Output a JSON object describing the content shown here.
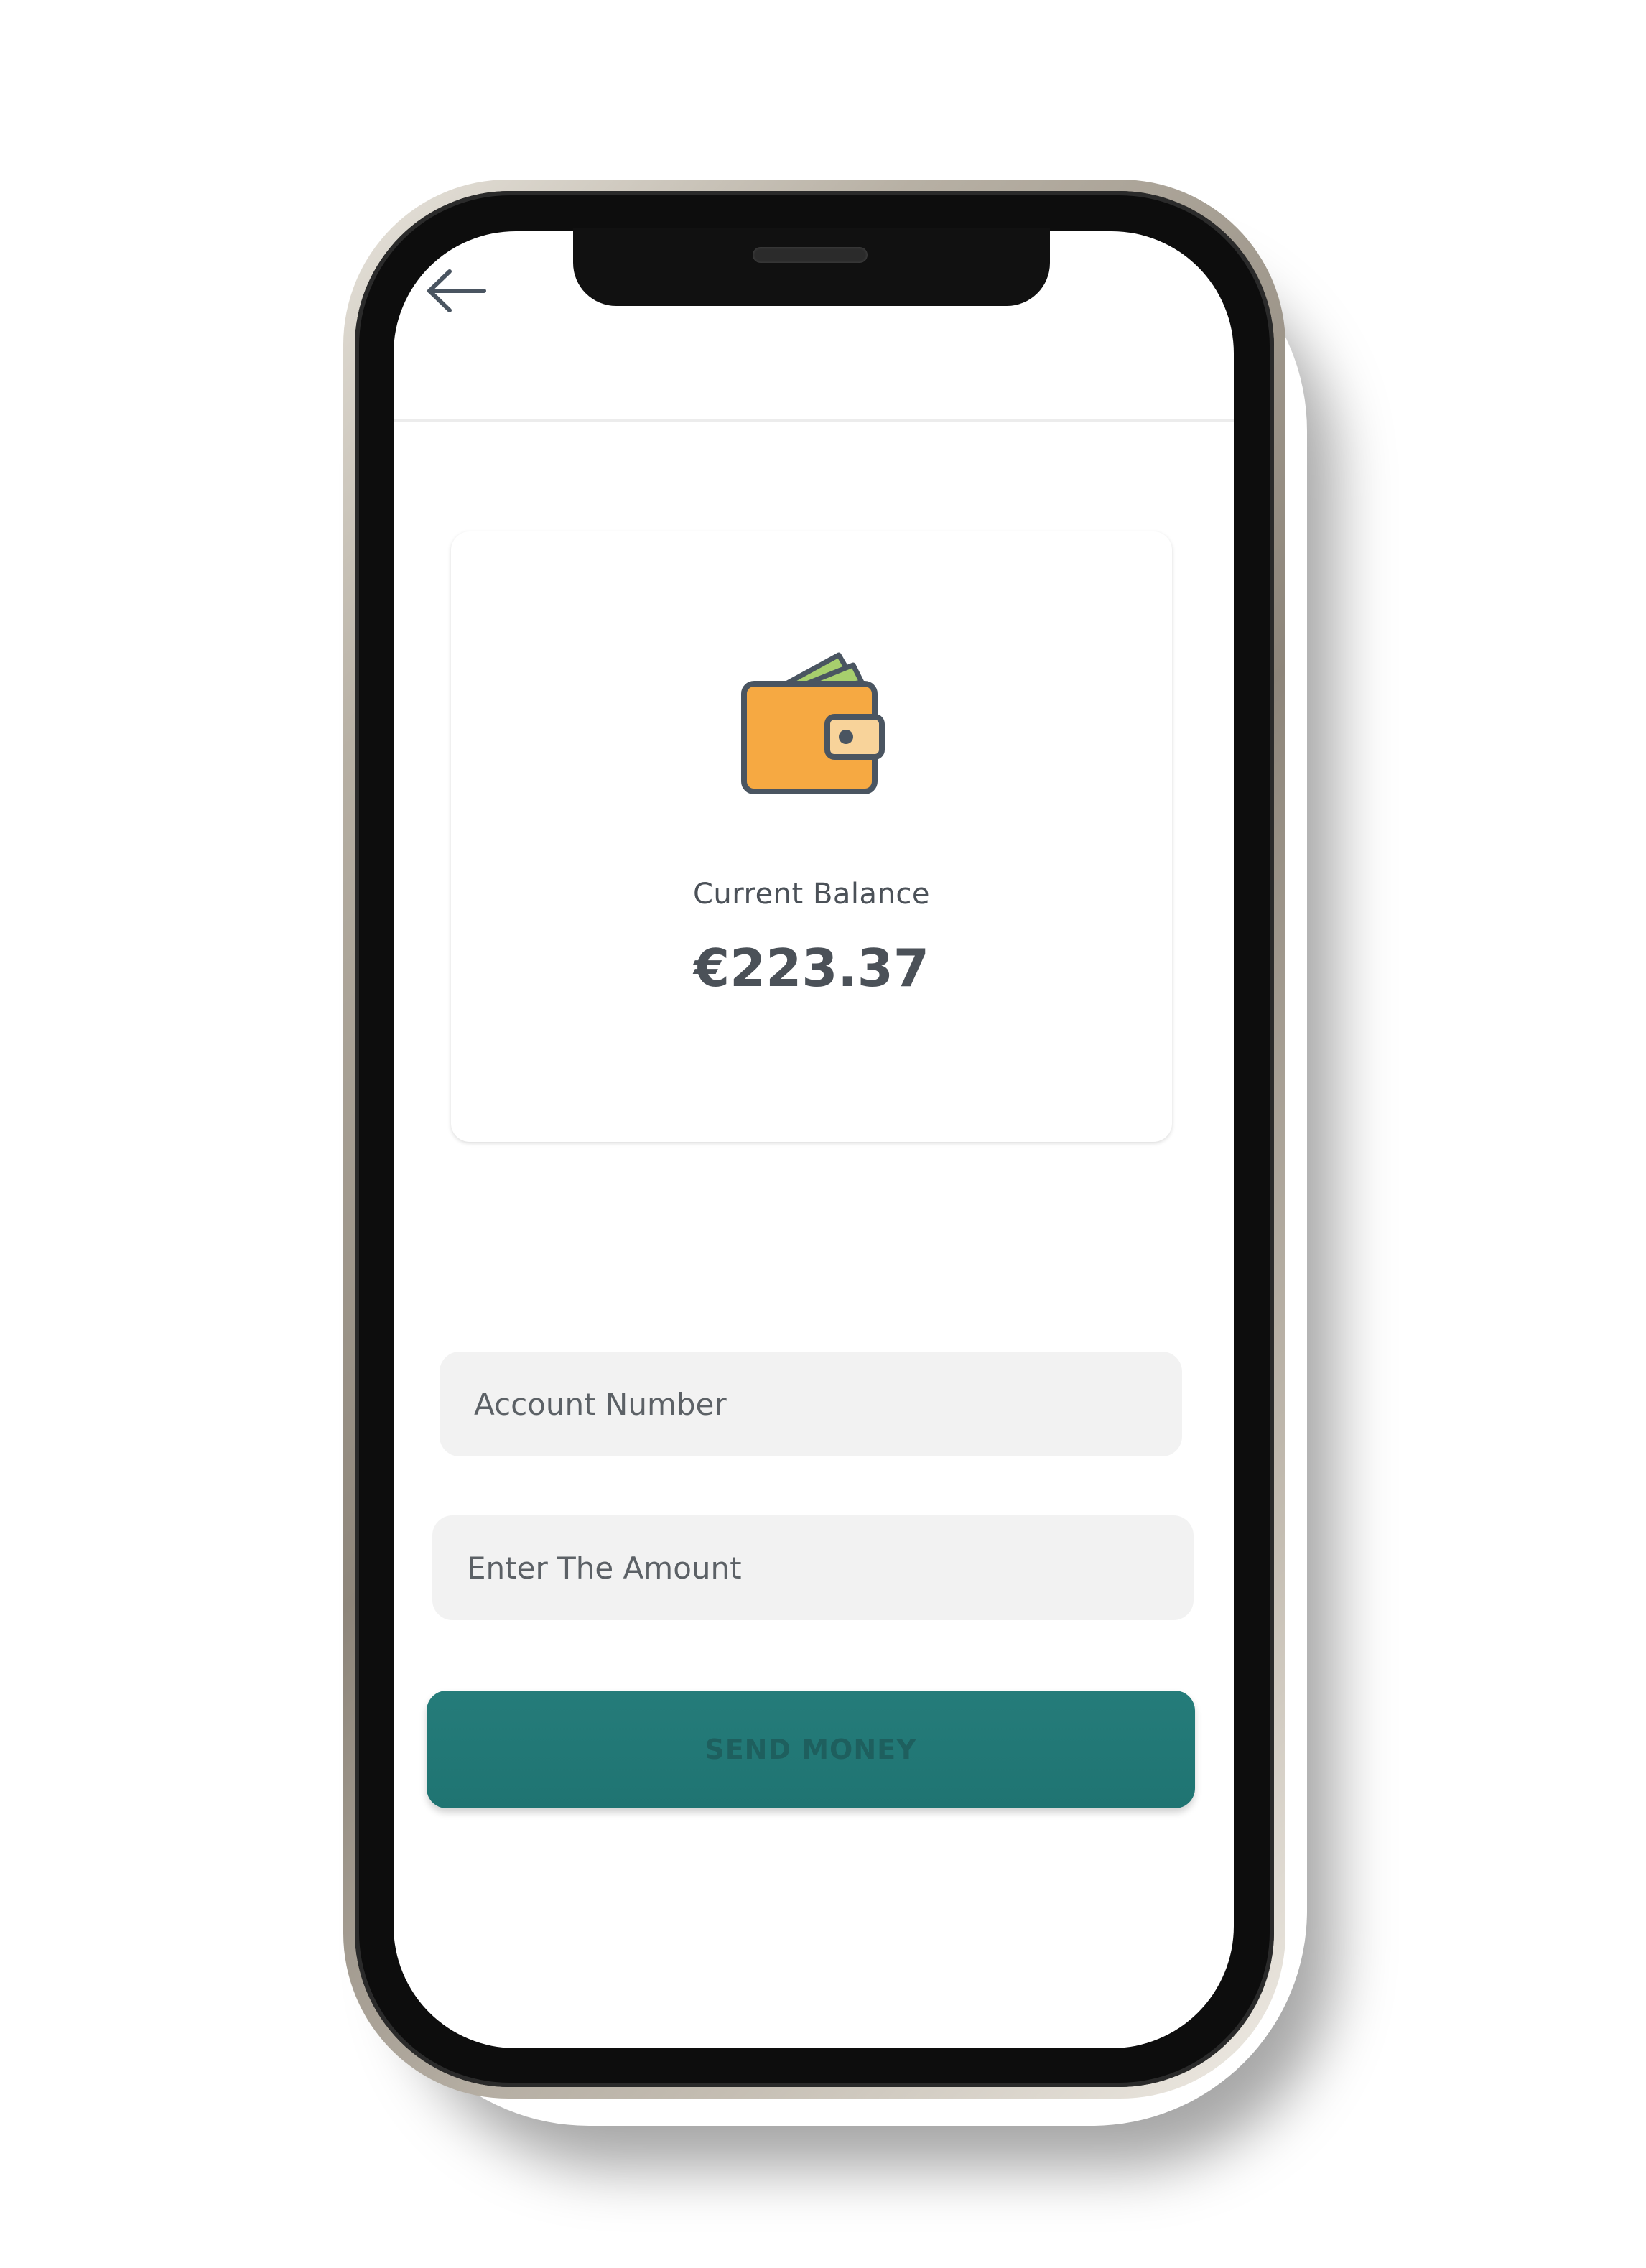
{
  "header": {
    "back_icon": "arrow-left-icon"
  },
  "balance_card": {
    "icon": "wallet-icon",
    "label": "Current Balance",
    "amount": "€223.37"
  },
  "form": {
    "account_placeholder": "Account Number",
    "amount_placeholder": "Enter The Amount",
    "send_label": "SEND MONEY"
  },
  "colors": {
    "primary": "#217472",
    "wallet_body": "#F6A942",
    "wallet_outline": "#4A5561",
    "cash_green": "#A7CF6D",
    "text": "#4B5158",
    "input_bg": "#F2F2F2"
  }
}
